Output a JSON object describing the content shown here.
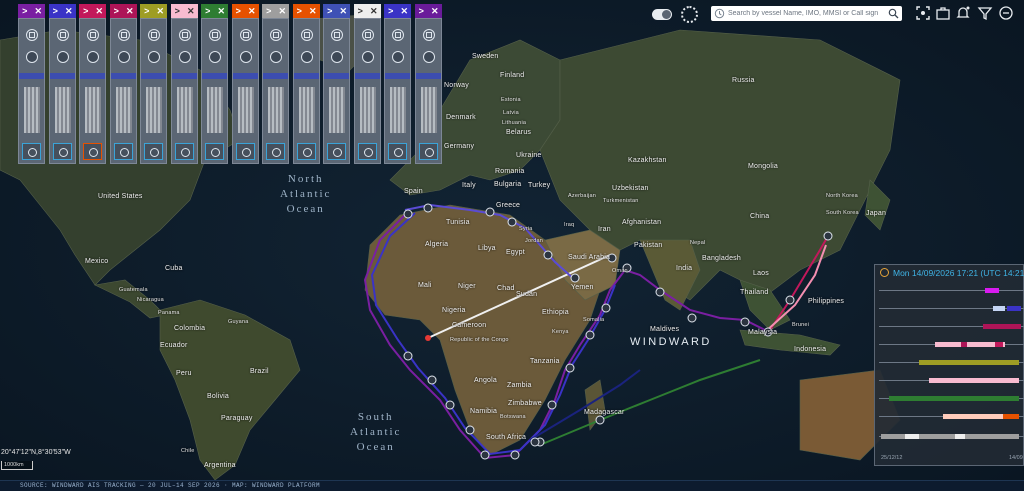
{
  "map_labels": {
    "countries": [
      "Sweden",
      "Finland",
      "Russia",
      "Norway",
      "Estonia",
      "Latvia",
      "Lithuania",
      "Denmark",
      "Belarus",
      "Ukraine",
      "Germany",
      "Romania",
      "Bulgaria",
      "Italy",
      "Spain",
      "Greece",
      "Turkey",
      "Kazakhstan",
      "Mongolia",
      "Uzbekistan",
      "Turkmenistan",
      "Azerbaijan",
      "Syria",
      "Iraq",
      "Iran",
      "Afghanistan",
      "Pakistan",
      "Nepal",
      "China",
      "North Korea",
      "South Korea",
      "Japan",
      "Tunisia",
      "Algeria",
      "Libya",
      "Egypt",
      "Saudi Arabia",
      "India",
      "Bangladesh",
      "Laos",
      "Thailand",
      "Philippines",
      "Brunei",
      "Malaysia",
      "Indonesia",
      "Maldives",
      "Mali",
      "Niger",
      "Chad",
      "Sudan",
      "Yemen",
      "Nigeria",
      "Ethiopia",
      "Cameroon",
      "Republic of the Congo",
      "Somalia",
      "Kenya",
      "Tanzania",
      "Angola",
      "Zambia",
      "Zimbabwe",
      "Namibia",
      "Botswana",
      "South Africa",
      "Madagascar",
      "United States",
      "Mexico",
      "Cuba",
      "Guatemala",
      "Nicaragua",
      "Panama",
      "Guyana",
      "Colombia",
      "Ecuador",
      "Peru",
      "Brazil",
      "Bolivia",
      "Paraguay",
      "Argentina",
      "Chile",
      "Jordan",
      "Oman"
    ],
    "oceans": [
      "North\nAtlantic\nOcean",
      "South\nAtlantic\nOcean"
    ],
    "brand": "WINDWARD"
  },
  "vessel_cards": [
    {
      "color": "#7a1fa2"
    },
    {
      "color": "#3a33c6"
    },
    {
      "color": "#c2185b"
    },
    {
      "color": "#ad1457"
    },
    {
      "color": "#9e9d24"
    },
    {
      "color": "#f8bbd0"
    },
    {
      "color": "#2e7d32"
    },
    {
      "color": "#e65100"
    },
    {
      "color": "#9e9e9e"
    },
    {
      "color": "#e65100"
    },
    {
      "color": "#3f51b5"
    },
    {
      "color": "#eeeeee"
    },
    {
      "color": "#3a33c6"
    },
    {
      "color": "#6a1b9a"
    }
  ],
  "header": {
    "search_placeholder": "Search by vessel Name, IMO, MMSI or Call sign"
  },
  "timeline": {
    "datetime": "Mon 14/09/2026 17:21 (UTC 14:21)",
    "axis_start": "25/12/12",
    "axis_end": "14/09"
  },
  "map_overlay": {
    "coords": "20°47'12\"N,8°30'53\"W",
    "scale": "1000km"
  },
  "footer": "SOURCE: WINDWARD AIS TRACKING — 20 JUL–14 SEP 2026 · MAP: WINDWARD PLATFORM"
}
